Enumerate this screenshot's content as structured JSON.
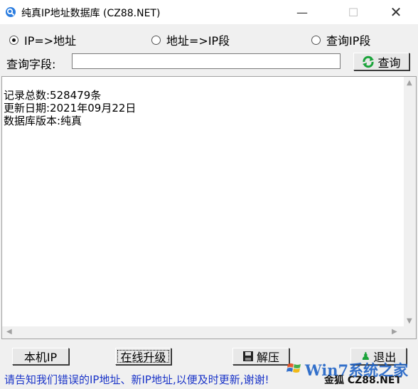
{
  "window": {
    "title": "纯真IP地址数据库 (CZ88.NET)",
    "controls": {
      "minimize": "—",
      "maximize": "☐",
      "close": "✕"
    }
  },
  "search_mode": {
    "options": [
      "IP=>地址",
      "地址=>IP段",
      "查询IP段"
    ],
    "selected": "IP=>地址"
  },
  "query": {
    "label": "查询字段:",
    "value": "",
    "button_label": "查询"
  },
  "result": {
    "lines": [
      "记录总数:528479条",
      "更新日期:2021年09月22日",
      "数据库版本:纯真"
    ]
  },
  "bottom_buttons": {
    "local_ip": "本机IP",
    "upgrade": "在线升级",
    "unzip": "解压",
    "exit": "退出"
  },
  "status": {
    "message": "请告知我们错误的IP地址、新IP地址,以便及时更新,谢谢!",
    "brand": "金狐 CZ88.NET"
  },
  "watermark": {
    "text": "Win7系统之家"
  },
  "colors": {
    "status_text": "#1a34c8",
    "refresh_icon": "#1aa33a",
    "app_icon": "#2b7de0"
  }
}
